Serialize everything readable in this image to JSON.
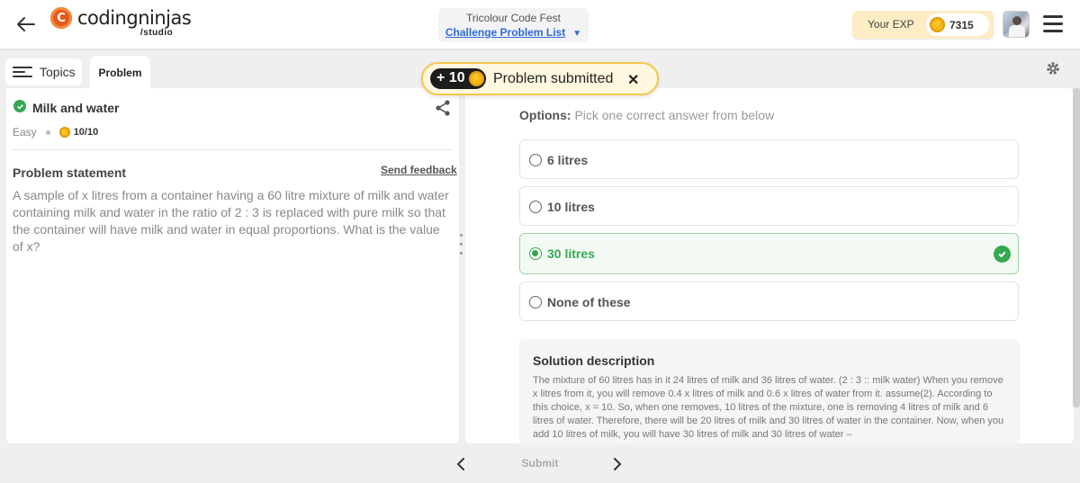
{
  "header": {
    "logo_text_regular": "coding",
    "logo_text_bold": "ninjas",
    "logo_mark": "C",
    "logo_sub": "/studio",
    "event_title": "Tricolour Code Fest",
    "event_link": "Challenge Problem List",
    "exp_label": "Your EXP",
    "exp_value": "7315"
  },
  "tabs": {
    "topics": "Topics",
    "problem": "Problem"
  },
  "problem": {
    "title": "Milk and water",
    "difficulty": "Easy",
    "score": "10/10",
    "statement_heading": "Problem statement",
    "send_feedback": "Send feedback",
    "statement": "A sample of x litres from a container having a 60 litre mixture of milk and water containing milk and water in the ratio of 2 : 3 is replaced with pure milk so that the container will have milk and water in equal proportions. What is the value of x?"
  },
  "toast": {
    "points": "+ 10",
    "message": "Problem submitted",
    "close": "✕"
  },
  "options": {
    "heading_label": "Options:",
    "heading_hint": "Pick one correct answer from below",
    "items": [
      {
        "label": "6 litres",
        "selected": false
      },
      {
        "label": "10 litres",
        "selected": false
      },
      {
        "label": "30 litres",
        "selected": true
      },
      {
        "label": "None of these",
        "selected": false
      }
    ]
  },
  "solution": {
    "title": "Solution description",
    "text": "The mixture of 60 litres has in it 24 litres of milk and 36 litres of water. (2 : 3 :: milk water) When you remove x litres from it, you will remove 0.4 x litres of milk and 0.6 x litres of water from it. assume(2). According to this choice, x = 10. So, when one removes, 10 litres of the mixture, one is removing 4 litres of milk and 6 litres of water. Therefore, there will be 20 litres of milk and 30 litres of water in the container. Now, when you add 10 litres of milk, you will have 30 litres of milk and 30 litres of water –"
  },
  "footer": {
    "submit": "Submit"
  },
  "colors": {
    "brand_orange": "#e8591a",
    "success_green": "#36a852",
    "link_blue": "#2e6bd6",
    "exp_bg": "#fdecc4",
    "coin_gold": "#f4b81c"
  },
  "icons": [
    "back-arrow-icon",
    "chevron-down-icon",
    "coin-icon",
    "hamburger-menu-icon",
    "topics-list-icon",
    "settings-gear-icon",
    "check-circle-icon",
    "share-icon",
    "close-icon",
    "chevron-left-icon",
    "chevron-right-icon"
  ]
}
